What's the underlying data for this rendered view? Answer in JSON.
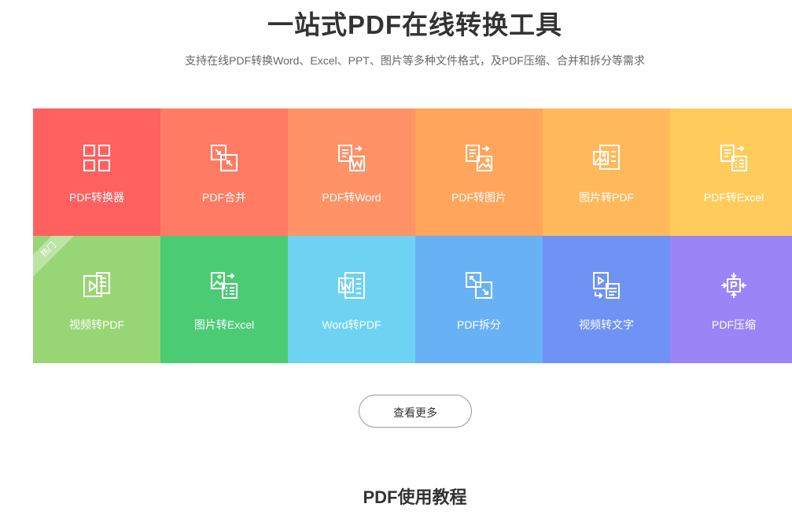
{
  "hero": {
    "title": "一站式PDF在线转换工具",
    "subtitle": "支持在线PDF转换Word、Excel、PPT、图片等多种文件格式，及PDF压缩、合并和拆分等需求"
  },
  "tools": [
    {
      "label": "PDF转换器",
      "color": "#ff6060",
      "icon": "grid-icon"
    },
    {
      "label": "PDF合并",
      "color": "#ff7b63",
      "icon": "merge-icon"
    },
    {
      "label": "PDF转Word",
      "color": "#ff9266",
      "icon": "pdf-to-word-icon"
    },
    {
      "label": "PDF转图片",
      "color": "#ffa65c",
      "icon": "pdf-to-image-icon"
    },
    {
      "label": "图片转PDF",
      "color": "#ffb95a",
      "icon": "image-to-pdf-icon"
    },
    {
      "label": "PDF转Excel",
      "color": "#ffcc5c",
      "icon": "pdf-to-excel-icon"
    },
    {
      "label": "视频转PDF",
      "color": "#98d675",
      "icon": "video-to-pdf-icon",
      "badge": "热门"
    },
    {
      "label": "图片转Excel",
      "color": "#4ccb75",
      "icon": "image-to-excel-icon"
    },
    {
      "label": "Word转PDF",
      "color": "#6ed3f3",
      "icon": "word-to-pdf-icon"
    },
    {
      "label": "PDF拆分",
      "color": "#69b1f5",
      "icon": "split-icon"
    },
    {
      "label": "视频转文字",
      "color": "#6f93f5",
      "icon": "video-to-text-icon"
    },
    {
      "label": "PDF压缩",
      "color": "#9a85f6",
      "icon": "compress-icon"
    }
  ],
  "more_button": "查看更多",
  "section_title": "PDF使用教程"
}
